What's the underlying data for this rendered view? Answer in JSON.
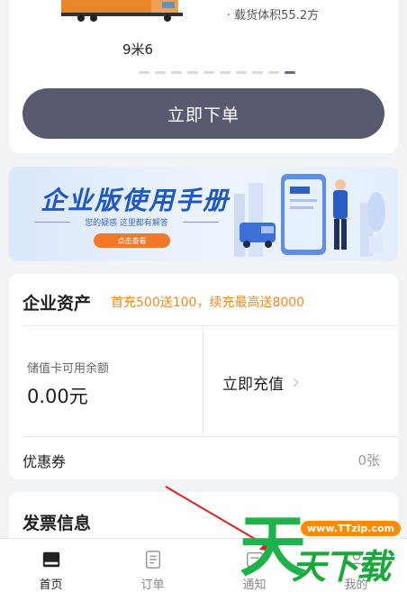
{
  "vehicle": {
    "spec": "载货体积55.2方",
    "spec_bullet": "·",
    "model": "9米6",
    "carousel_total": 10,
    "carousel_active_index": 9
  },
  "order_button": "立即下单",
  "banner": {
    "title": "企业版使用手册",
    "subtitle": "您的疑惑 这里都有解答",
    "button": "点击查看",
    "colors": {
      "title": "#1d57c8",
      "button": "#f07a2a"
    }
  },
  "assets": {
    "title": "企业资产",
    "promo": "首充500送100，续充最高送8000",
    "balance_label": "储值卡可用余额",
    "balance_value": "0.00元",
    "recharge_label": "立即充值",
    "coupon_label": "优惠券",
    "coupon_count": "0张",
    "colors": {
      "promo": "#f08a1c"
    }
  },
  "invoice": {
    "title": "发票信息"
  },
  "tabbar": {
    "items": [
      {
        "label": "首页",
        "icon": "home-icon",
        "active": true
      },
      {
        "label": "订单",
        "icon": "order-list-icon",
        "active": false
      },
      {
        "label": "通知",
        "icon": "notification-icon",
        "active": false
      },
      {
        "label": "我的",
        "icon": "profile-icon",
        "active": false
      }
    ]
  },
  "watermark": {
    "url": "www.TTzip.com",
    "big": "天",
    "text": "天下载"
  },
  "colors": {
    "order_button": "#585a70",
    "background": "#f2f3f5"
  }
}
